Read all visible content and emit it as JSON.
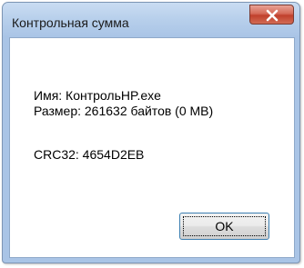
{
  "window": {
    "title": "Контрольная сумма",
    "close_icon": "close-icon"
  },
  "content": {
    "name_line": "Имя: КонтрольHP.exe",
    "size_line": "Размер: 261632 байтов (0 MB)",
    "crc_line": "CRC32: 4654D2EB"
  },
  "buttons": {
    "ok_label": "OK"
  },
  "colors": {
    "titlebar": "#b7cfeb",
    "close_button": "#c0402c",
    "focus_border": "#3c7fb1"
  }
}
